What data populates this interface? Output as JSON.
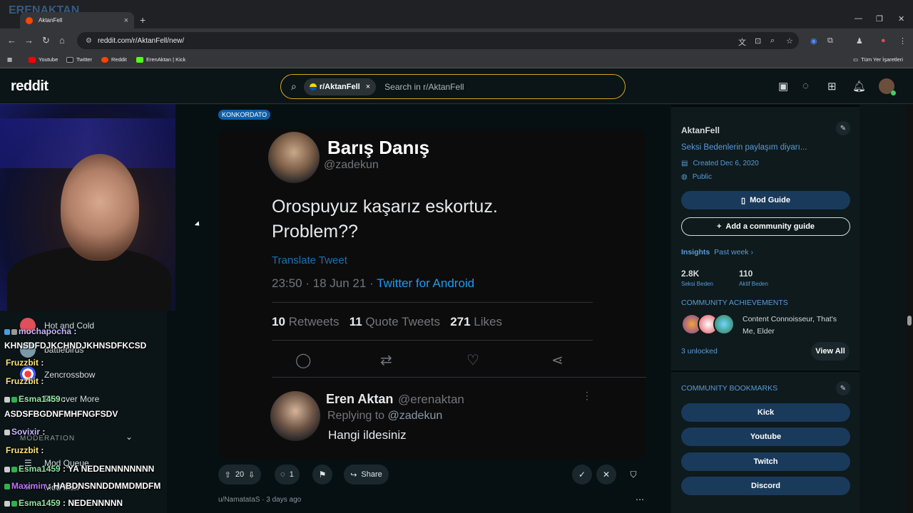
{
  "browser": {
    "tab_title": "AktanFell",
    "url": "reddit.com/r/AktanFell/new/",
    "watermark": "ERENAKTAN",
    "bookmarks": [
      {
        "label": "Youtube",
        "color": "#ff0000"
      },
      {
        "label": "Twitter",
        "color": "#222222"
      },
      {
        "label": "Reddit",
        "color": "#ff4500"
      },
      {
        "label": "ErenAktan | Kick",
        "color": "#53fc18"
      }
    ],
    "all_bookmarks_label": "Tüm Yer İşaretleri"
  },
  "reddit": {
    "logo": "reddit",
    "search_chip": "r/AktanFell",
    "search_placeholder": "Search in r/AktanFell"
  },
  "post": {
    "flair": "KONKORDATO",
    "tweet": {
      "name": "Barış Danış",
      "handle": "@zadekun",
      "text": "Orospuyuz kaşarız eskortuz. Problem??",
      "translate": "Translate Tweet",
      "time": "23:50 · 18 Jun 21 · ",
      "client": "Twitter for Android",
      "retweets_count": "10",
      "retweets_label": "Retweets",
      "quotes_count": "11",
      "quotes_label": "Quote Tweets",
      "likes_count": "271",
      "likes_label": "Likes"
    },
    "reply": {
      "name": "Eren Aktan",
      "handle": "@erenaktan",
      "replying_prefix": "Replying to ",
      "replying_to": "@zadekun",
      "text": "Hangi ildesiniz"
    },
    "votes": "20",
    "comments": "1",
    "share_label": "Share",
    "next_post_author": "u/NamatataS",
    "next_post_time": "3 days ago"
  },
  "sidebar": {
    "community": "AktanFell",
    "description": "Seksi Bedenlerin paylaşım diyarı...",
    "created": "Created Dec 6, 2020",
    "visibility": "Public",
    "mod_guide": "Mod Guide",
    "add_guide": "Add a community guide",
    "insights_label": "Insights",
    "insights_period": "Past week",
    "stats": [
      {
        "value": "2.8K",
        "label": "Seksi Beden"
      },
      {
        "value": "110",
        "label": "Aktif Beden"
      }
    ],
    "achievements_title": "COMMUNITY ACHIEVEMENTS",
    "achievements_text": "Content Connoisseur, That's Me, Elder",
    "unlocked": "3 unlocked",
    "view_all": "View All",
    "bookmarks_title": "COMMUNITY BOOKMARKS",
    "bookmark_items": [
      "Kick",
      "Youtube",
      "Twitch",
      "Discord"
    ]
  },
  "left_nav": {
    "items": [
      "Hot and Cold",
      "battlebirds",
      "Zencrossbow",
      "Discover More"
    ],
    "moderation_label": "MODERATION",
    "mod_items": [
      "Mod Queue",
      "Mod Mail"
    ]
  },
  "chat": [
    {
      "user": "mochapocha",
      "msg": ""
    },
    {
      "user": "",
      "msg": "KHNSDFDJKCHNDJKHNSDFKCSD"
    },
    {
      "user": "Fruzzbit",
      "msg": ""
    },
    {
      "user": "Fruzzbit",
      "msg": ""
    },
    {
      "user": "Esma1459",
      "msg": ""
    },
    {
      "user": "",
      "msg": "ASDSFBGDNFMHFNGFSDV"
    },
    {
      "user": "Sovixir",
      "msg": ""
    },
    {
      "user": "Fruzzbit",
      "msg": ""
    },
    {
      "user": "Esma1459",
      "msg": "YA NEDENNNNNNNN"
    },
    {
      "user": "Maximin",
      "msg": "HABDNSNNDDMMDMDFM"
    },
    {
      "user": "Esma1459",
      "msg": "NEDENNNNN"
    }
  ],
  "colors": {
    "accent": "#d7a51c",
    "link": "#5a9bd8",
    "reddit_orange": "#ff4500",
    "twitter_blue": "#1d9bf0"
  }
}
